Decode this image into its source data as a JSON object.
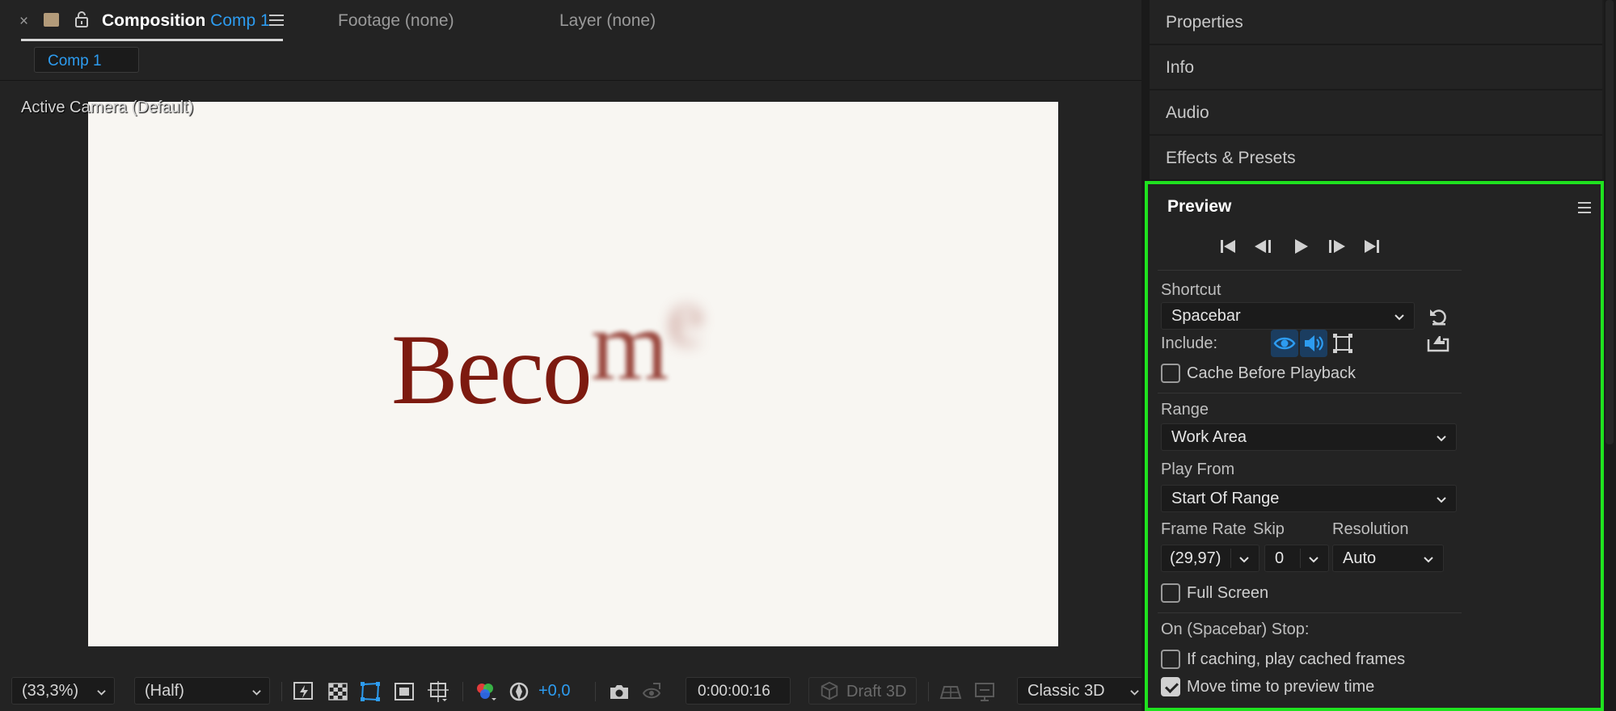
{
  "composition_panel": {
    "tabs": {
      "close_glyph": "×",
      "composition_label": "Composition",
      "composition_name": "Comp 1",
      "footage_label": "Footage (none)",
      "layer_label": "Layer (none)"
    },
    "comp_chip": "Comp 1",
    "viewer": {
      "camera_label": "Active Camera (Default)",
      "canvas_text_main": "Beco",
      "canvas_text_blur1": "m",
      "canvas_text_blur2": "e",
      "canvas_background": "#f8f6f2",
      "text_color": "#7d1a10"
    },
    "toolbar": {
      "zoom": "(33,3%)",
      "resolution": "(Half)",
      "exposure": "+0,0",
      "timecode": "0:00:00:16",
      "draft3d": "Draft 3D",
      "renderer": "Classic 3D"
    }
  },
  "right_panels": {
    "collapsed": [
      "Properties",
      "Info",
      "Audio",
      "Effects & Presets"
    ],
    "preview": {
      "title": "Preview",
      "shortcut_label": "Shortcut",
      "shortcut_value": "Spacebar",
      "include_label": "Include:",
      "cache_before_playback": "Cache Before Playback",
      "range_label": "Range",
      "range_value": "Work Area",
      "play_from_label": "Play From",
      "play_from_value": "Start Of Range",
      "frame_rate_label": "Frame Rate",
      "frame_rate_value": "(29,97)",
      "skip_label": "Skip",
      "skip_value": "0",
      "resolution_label": "Resolution",
      "resolution_value": "Auto",
      "full_screen": "Full Screen",
      "on_stop_label": "On (Spacebar) Stop:",
      "if_caching": "If caching, play cached frames",
      "move_time": "Move time to preview time",
      "highlight_color": "#1fe21f",
      "accent_color": "#2d9cf0"
    }
  }
}
